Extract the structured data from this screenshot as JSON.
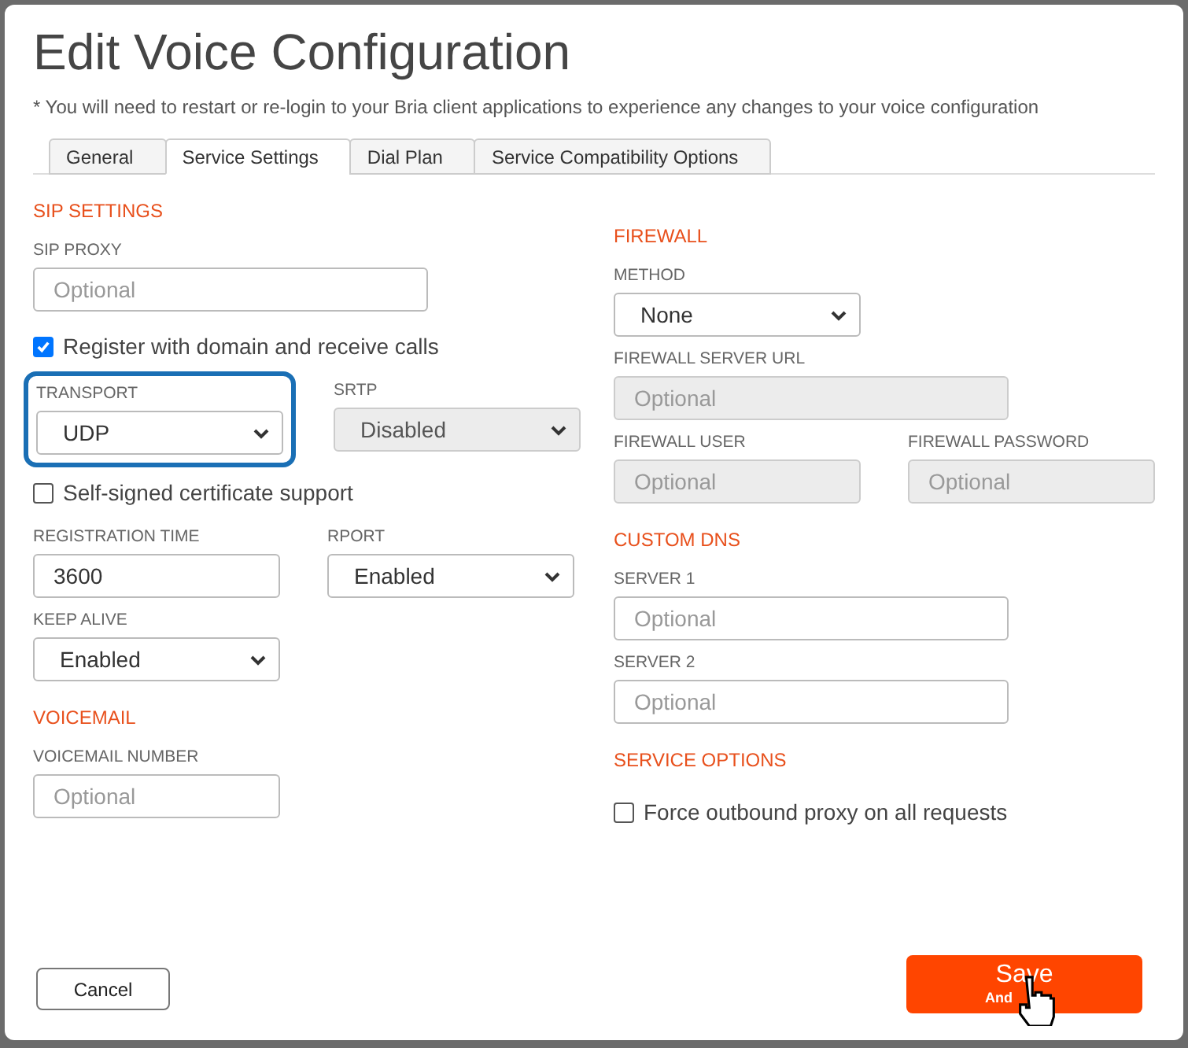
{
  "title": "Edit Voice Configuration",
  "notice": "* You will need to restart or re-login to your Bria client applications to experience any changes to your voice configuration",
  "tabs": [
    {
      "label": "General",
      "selected": false
    },
    {
      "label": "Service Settings",
      "selected": true
    },
    {
      "label": "Dial Plan",
      "selected": false
    },
    {
      "label": "Service Compatibility Options",
      "selected": false
    }
  ],
  "columns": [
    {
      "sections": [
        {
          "heading": "SIP SETTINGS",
          "rows": [
            [
              {
                "kind": "text",
                "label": "SIP PROXY",
                "placeholder": "Optional",
                "disabled": false,
                "wide": true
              }
            ],
            [
              {
                "kind": "checkbox",
                "label": "Register with domain and receive calls",
                "checked": true
              }
            ],
            [
              {
                "kind": "select",
                "label": "TRANSPORT",
                "value": "UDP",
                "disabled": false,
                "highlighted": true
              },
              {
                "kind": "select",
                "label": "SRTP",
                "value": "Disabled",
                "disabled": true
              }
            ],
            [
              {
                "kind": "checkbox",
                "label": "Self-signed certificate support",
                "checked": false
              }
            ],
            [
              {
                "kind": "text",
                "label": "REGISTRATION TIME",
                "value": "3600",
                "disabled": false,
                "wide": false
              },
              {
                "kind": "select",
                "label": "RPORT",
                "value": "Enabled",
                "disabled": false
              }
            ],
            [
              {
                "kind": "select",
                "label": "KEEP ALIVE",
                "value": "Enabled",
                "disabled": false
              }
            ]
          ]
        },
        {
          "heading": "VOICEMAIL",
          "rows": [
            [
              {
                "kind": "text",
                "label": "VOICEMAIL NUMBER",
                "placeholder": "Optional",
                "disabled": false,
                "wide": false
              }
            ]
          ]
        }
      ]
    },
    {
      "sections": [
        {
          "heading": "FIREWALL",
          "rows": [
            [
              {
                "kind": "select",
                "label": "METHOD",
                "value": "None",
                "disabled": false
              }
            ],
            [
              {
                "kind": "text",
                "label": "FIREWALL SERVER URL",
                "placeholder": "Optional",
                "disabled": true,
                "wide": true
              }
            ],
            [
              {
                "kind": "text",
                "label": "FIREWALL USER",
                "placeholder": "Optional",
                "disabled": true,
                "wide": false
              },
              {
                "kind": "text",
                "label": "FIREWALL PASSWORD",
                "placeholder": "Optional",
                "disabled": true,
                "wide": false
              }
            ]
          ]
        },
        {
          "heading": "CUSTOM DNS",
          "rows": [
            [
              {
                "kind": "text",
                "label": "SERVER 1",
                "placeholder": "Optional",
                "disabled": false,
                "wide": true
              }
            ],
            [
              {
                "kind": "text",
                "label": "SERVER 2",
                "placeholder": "Optional",
                "disabled": false,
                "wide": true
              }
            ]
          ]
        },
        {
          "heading": "SERVICE OPTIONS",
          "rows": [
            [
              {
                "kind": "checkbox",
                "label": "Force outbound proxy on all requests",
                "checked": false
              }
            ]
          ]
        }
      ]
    }
  ],
  "cancel_button": "Cancel",
  "save_button": {
    "label": "Save",
    "sublabel": "And"
  }
}
